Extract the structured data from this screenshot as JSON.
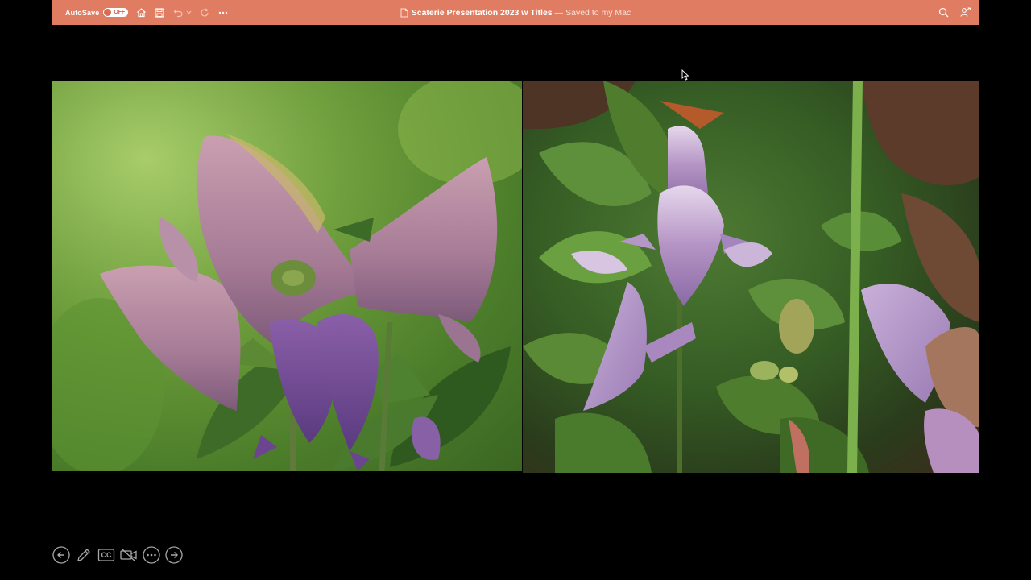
{
  "titlebar": {
    "autosave_label": "AutoSave",
    "autosave_state": "OFF",
    "document_title": "Scaterie Presentation 2023 w Titles",
    "separator": "—",
    "save_status": "Saved to my Mac",
    "background_color": "#e07c62"
  },
  "presenter_controls": {
    "cc_label": "CC"
  },
  "slide": {
    "images": [
      {
        "description_icon": "gentian-flower-photo-left"
      },
      {
        "description_icon": "gentian-flower-photo-right"
      }
    ]
  }
}
